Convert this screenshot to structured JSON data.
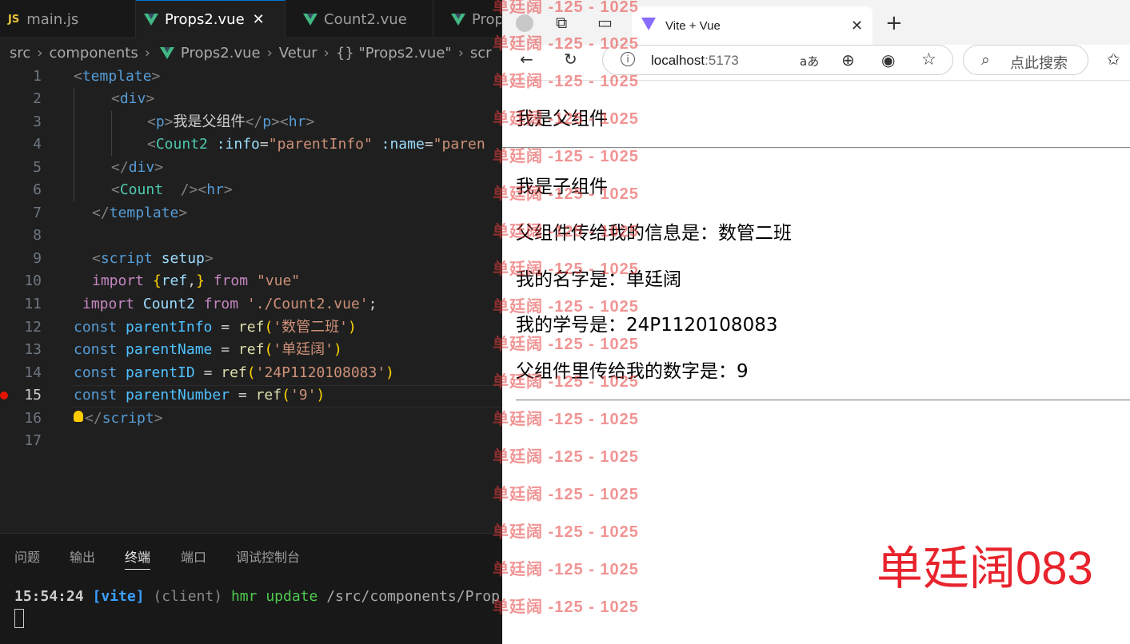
{
  "editor": {
    "tabs": [
      {
        "label": "main.js",
        "icon": "js-icon"
      },
      {
        "label": "Props2.vue",
        "icon": "vue-icon",
        "active": true,
        "close": "✕"
      },
      {
        "label": "Count2.vue",
        "icon": "vue-icon"
      },
      {
        "label": "Prop",
        "icon": "vue-icon"
      }
    ],
    "breadcrumb": [
      "src",
      "components",
      "Props2.vue",
      "Vetur",
      "{} \"Props2.vue\"",
      "scr"
    ],
    "line_numbers": [
      "1",
      "2",
      "3",
      "4",
      "5",
      "6",
      "7",
      "8",
      "9",
      "10",
      "11",
      "12",
      "13",
      "14",
      "15",
      "16",
      "17"
    ],
    "current_line": "15",
    "code": {
      "l1": [
        "<",
        "template",
        ">"
      ],
      "l2": [
        "<",
        "div",
        ">"
      ],
      "l3": [
        "<",
        "p",
        ">",
        "我是父组件",
        "</",
        "p",
        "><",
        "hr",
        ">"
      ],
      "l4": [
        "<",
        "Count2",
        " :info",
        "=",
        "\"parentInfo\"",
        " :name",
        "=",
        "\"paren"
      ],
      "l5": [
        "</",
        "div",
        ">"
      ],
      "l6": [
        "<",
        "Count",
        "  />",
        "<",
        "hr",
        ">"
      ],
      "l7": [
        "</",
        "template",
        ">"
      ],
      "l9": [
        "<",
        "script",
        " setup",
        ">"
      ],
      "l10": [
        "import",
        " {",
        "ref",
        ",",
        "}",
        " from",
        " \"vue\""
      ],
      "l11": [
        "import",
        " Count2",
        " from",
        " './Count2.vue'",
        ";"
      ],
      "l12": [
        "const",
        " parentInfo",
        " = ",
        "ref",
        "(",
        "'数管二班'",
        ")"
      ],
      "l13": [
        "const",
        " parentName",
        " = ",
        "ref",
        "(",
        "'单廷阔'",
        ")"
      ],
      "l14": [
        "const",
        " parentID",
        " = ",
        "ref",
        "(",
        "'24P1120108083'",
        ")"
      ],
      "l15": [
        "const",
        " parentNumber",
        " = ",
        "ref",
        "(",
        "'9'",
        ")"
      ],
      "l16": [
        "</",
        "script",
        ">"
      ]
    }
  },
  "panel": {
    "tabs": [
      "问题",
      "输出",
      "终端",
      "端口",
      "调试控制台"
    ],
    "active_tab": "终端",
    "terminal": {
      "time": "15:54:24",
      "tag": "[vite]",
      "client": "(client)",
      "msg": "hmr update",
      "path": "/src/components/Prop"
    }
  },
  "browser": {
    "tab_title": "Vite + Vue",
    "tab_close": "✕",
    "new_tab": "+",
    "url_host": "localhost",
    "url_port": ":5173",
    "read_aloud": "aあ",
    "search_placeholder": "点此搜索"
  },
  "page": {
    "parent_text": "我是父组件",
    "child_text": "我是子组件",
    "info_text": "父组件传给我的信息是：数管二班",
    "name_text": "我的名字是：单廷阔",
    "id_text": "我的学号是：24P1120108083",
    "number_text": "父组件里传给我的数字是：9"
  },
  "watermark": {
    "text": "单廷阔 -125 - 1025",
    "signature": "单廷阔083",
    "color": "#e8232c"
  },
  "colors": {
    "editor_bg": "#1f1f1f",
    "accent": "#0078d4",
    "vue_green": "#41b883"
  }
}
